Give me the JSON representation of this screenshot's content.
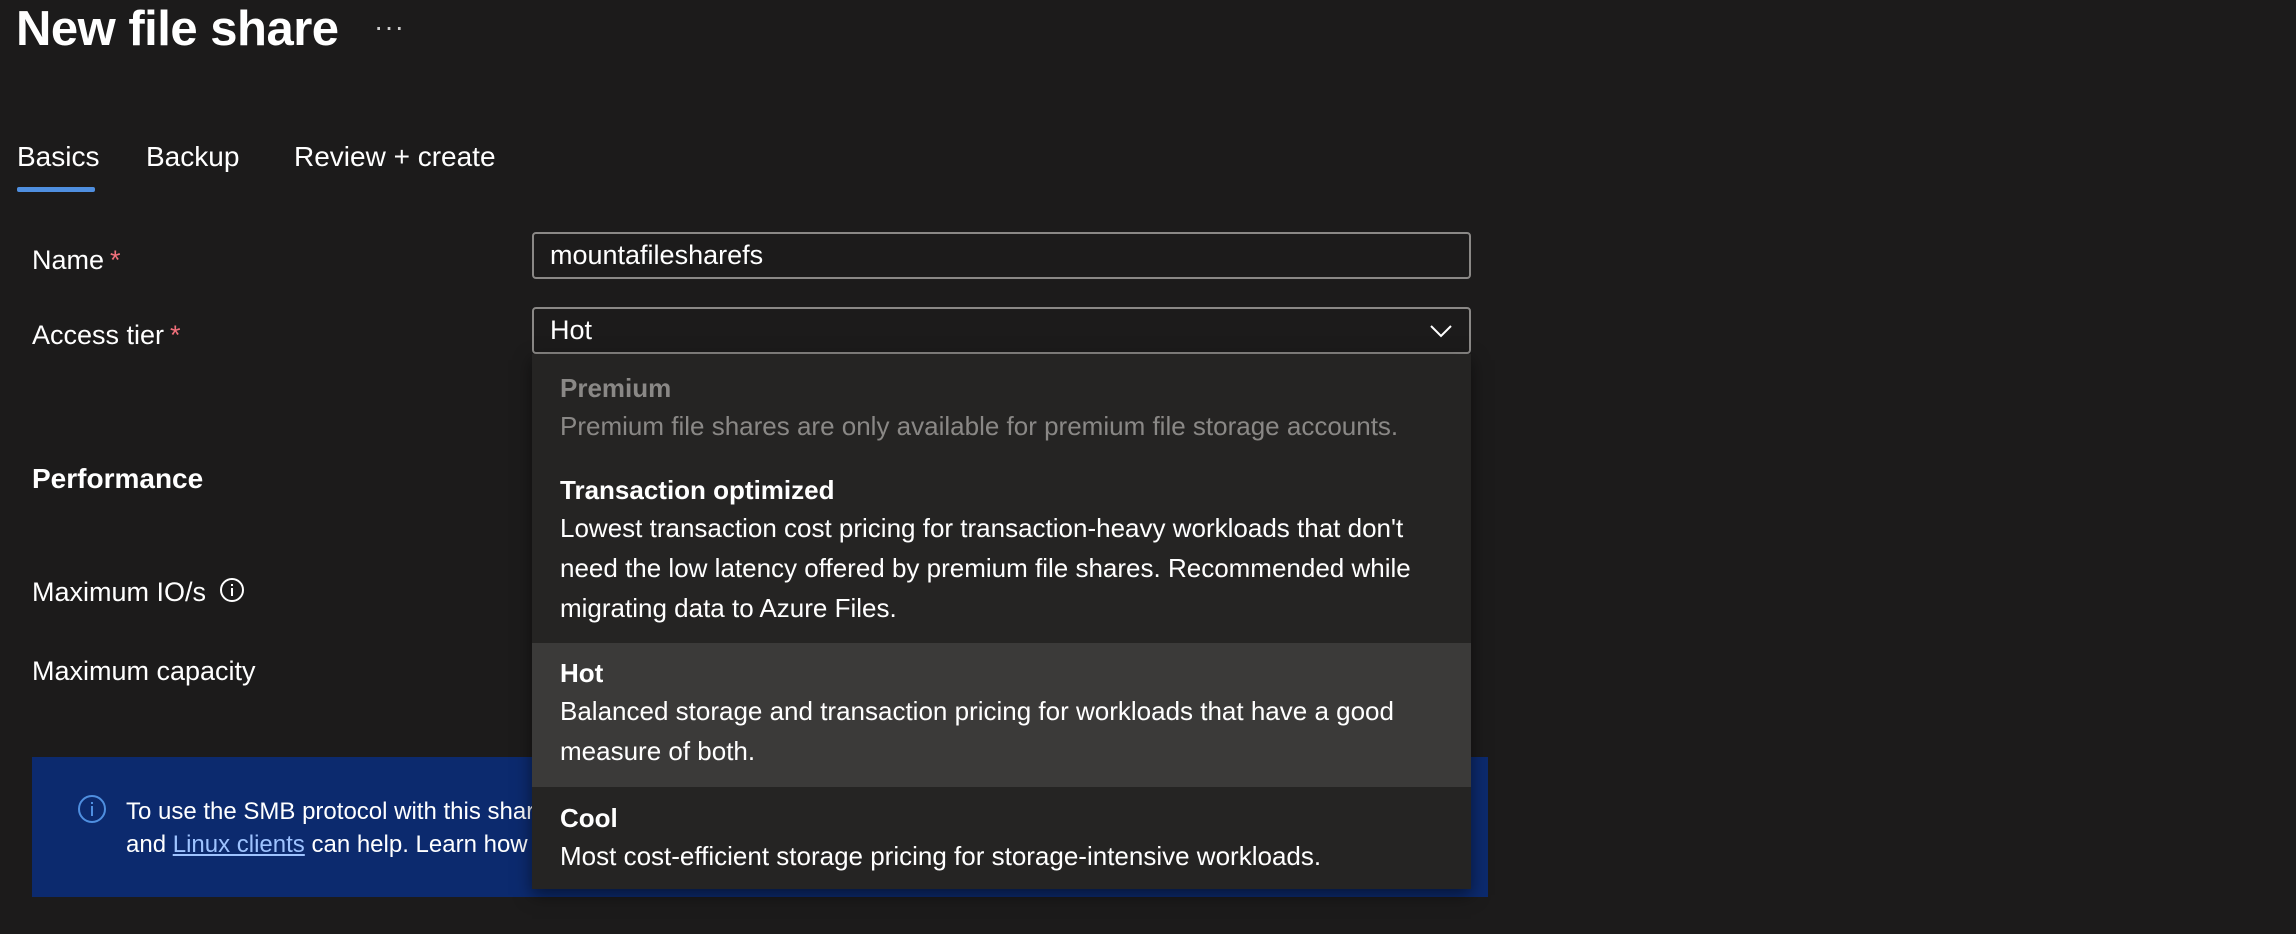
{
  "header": {
    "title": "New file share",
    "more_label": "···"
  },
  "tabs": [
    {
      "label": "Basics",
      "selected": true
    },
    {
      "label": "Backup"
    },
    {
      "label": "Review + create"
    }
  ],
  "form": {
    "name_label": "Name",
    "required_mark": "*",
    "name_value": "mountafilesharefs",
    "access_tier_label": "Access tier",
    "access_tier_value": "Hot"
  },
  "performance": {
    "heading": "Performance",
    "max_io_label": "Maximum IO/s",
    "max_capacity_label": "Maximum capacity"
  },
  "dropdown": {
    "options": [
      {
        "title": "Premium",
        "description": "Premium file shares are only available for premium file storage accounts.",
        "disabled": true
      },
      {
        "title": "Transaction optimized",
        "description": "Lowest transaction cost pricing for transaction-heavy workloads that don't need the low latency offered by premium file shares. Recommended while migrating data to Azure Files."
      },
      {
        "title": "Hot",
        "description": "Balanced storage and transaction pricing for workloads that have a good measure of both.",
        "selected": true
      },
      {
        "title": "Cool",
        "description": "Most cost-efficient storage pricing for storage-intensive workloads."
      }
    ]
  },
  "banner": {
    "line1": "To use the SMB protocol with this shar",
    "line2_prefix": "and ",
    "link": "Linux clients",
    "line2_suffix": " can help. Learn how t"
  },
  "colors": {
    "background": "#1c1b1b",
    "accent": "#4f8fe0",
    "banner": "#0c2a6e",
    "required": "#f1707b",
    "dropdown_bg": "#252423",
    "selected_option": "#3b3a39"
  }
}
